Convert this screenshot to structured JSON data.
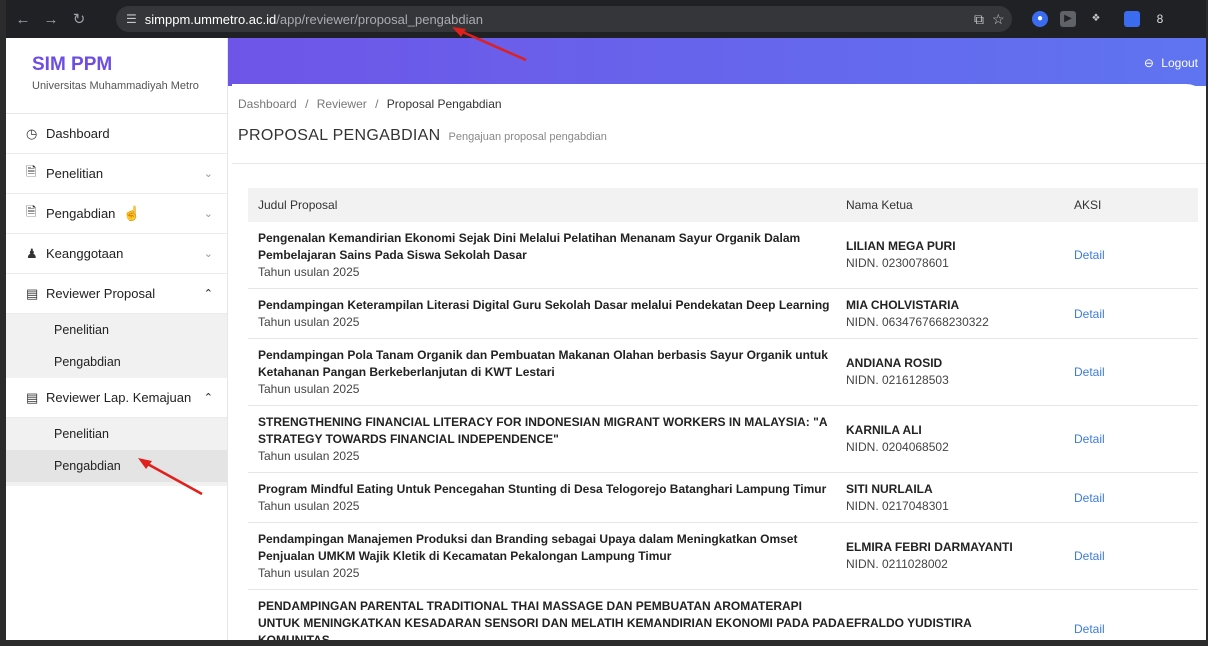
{
  "browser": {
    "url_domain": "simppm.ummetro.ac.id",
    "url_path": "/app/reviewer/proposal_pengabdian",
    "profile_initial": "8"
  },
  "sidebar": {
    "brand_title": "SIM PPM",
    "brand_subtitle": "Universitas Muhammadiyah Metro",
    "items": [
      {
        "label": "Dashboard"
      },
      {
        "label": "Penelitian"
      },
      {
        "label": "Pengabdian"
      },
      {
        "label": "Keanggotaan"
      },
      {
        "label": "Reviewer Proposal"
      },
      {
        "label": "Reviewer Lap. Kemajuan"
      }
    ],
    "reviewer_proposal_sub": [
      "Penelitian",
      "Pengabdian"
    ],
    "reviewer_kemajuan_sub": [
      "Penelitian",
      "Pengabdian"
    ]
  },
  "header": {
    "logout_label": "Logout"
  },
  "breadcrumb": {
    "dashboard": "Dashboard",
    "sep": "/",
    "reviewer": "Reviewer",
    "current": "Proposal Pengabdian"
  },
  "page": {
    "title": "PROPOSAL PENGABDIAN",
    "subtitle": "Pengajuan proposal pengabdian"
  },
  "table": {
    "headers": [
      "Judul Proposal",
      "Nama Ketua",
      "AKSI"
    ],
    "action_label": "Detail",
    "rows": [
      {
        "title": "Pengenalan Kemandirian Ekonomi Sejak Dini Melalui Pelatihan Menanam Sayur Organik Dalam Pembelajaran Sains Pada Siswa Sekolah Dasar",
        "year": "Tahun usulan 2025",
        "ketua": "LILIAN MEGA PURI",
        "nidn": "NIDN. 0230078601"
      },
      {
        "title": "Pendampingan Keterampilan Literasi Digital Guru Sekolah Dasar melalui Pendekatan Deep Learning",
        "year": "Tahun usulan 2025",
        "ketua": "MIA CHOLVISTARIA",
        "nidn": "NIDN. 0634767668230322"
      },
      {
        "title": "Pendampingan Pola Tanam Organik dan Pembuatan Makanan Olahan berbasis Sayur Organik untuk Ketahanan Pangan Berkeberlanjutan di KWT Lestari",
        "year": "Tahun usulan 2025",
        "ketua": "ANDIANA ROSID",
        "nidn": "NIDN. 0216128503"
      },
      {
        "title": "STRENGTHENING FINANCIAL LITERACY FOR INDONESIAN MIGRANT WORKERS IN MALAYSIA: \"A STRATEGY TOWARDS FINANCIAL INDEPENDENCE\"",
        "year": "Tahun usulan 2025",
        "ketua": "KARNILA ALI",
        "nidn": "NIDN. 0204068502"
      },
      {
        "title": "Program Mindful Eating Untuk Pencegahan Stunting di Desa Telogorejo Batanghari Lampung Timur",
        "year": "Tahun usulan 2025",
        "ketua": "SITI NURLAILA",
        "nidn": "NIDN. 0217048301"
      },
      {
        "title": "Pendampingan Manajemen Produksi dan Branding sebagai Upaya dalam Meningkatkan Omset Penjualan UMKM Wajik Kletik di Kecamatan Pekalongan Lampung Timur",
        "year": "Tahun usulan 2025",
        "ketua": "ELMIRA FEBRI DARMAYANTI",
        "nidn": "NIDN. 0211028002"
      },
      {
        "title": "PENDAMPINGAN PARENTAL TRADITIONAL THAI MASSAGE DAN PEMBUATAN AROMATERAPI UNTUK MENINGKATKAN KESADARAN SENSORI DAN MELATIH KEMANDIRIAN EKONOMI PADA PADA KOMUNITAS",
        "year": "",
        "ketua": "EFRALDO YUDISTIRA",
        "nidn": ""
      }
    ]
  },
  "colors": {
    "brand": "#6c4de6",
    "banner_start": "#6e55e8",
    "banner_end": "#5f74f0",
    "link": "#3d7be0",
    "annotation": "#e0201c"
  }
}
